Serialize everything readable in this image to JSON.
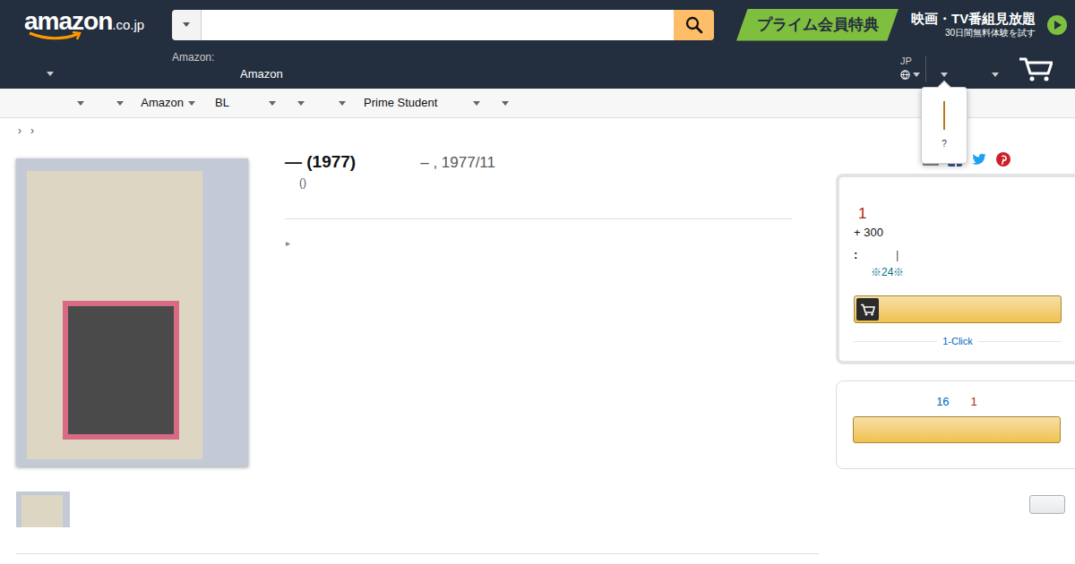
{
  "header": {
    "logo": {
      "text": "amazon",
      "suffix": ".co.jp"
    },
    "search": {
      "placeholder": ""
    },
    "prime_banner": {
      "badge": "プライム会員特典",
      "title": "映画・TV番組見放題",
      "subtitle": "30日間無料体験を試す"
    },
    "address": {
      "line1": "Amazon:",
      "line2": "Amazon"
    },
    "language": {
      "code": "JP"
    }
  },
  "nav": [
    {
      "label": ""
    },
    {
      "label": ""
    },
    {
      "label": "Amazon"
    },
    {
      "label": "BL"
    },
    {
      "label": ""
    },
    {
      "label": ""
    },
    {
      "label": "Prime Student"
    },
    {
      "label": ""
    }
  ],
  "tooltip": {
    "text": "?"
  },
  "breadcrumb": [
    "›",
    "›"
  ],
  "product": {
    "title": "— (1977)",
    "meta": "– , 1977/11",
    "byline": "()",
    "expander": "▸"
  },
  "buy_box": {
    "price": "1",
    "shipping": "+ 300",
    "delivery_label": ":",
    "delivery_value": "|",
    "note": "※24※",
    "one_click": "1-Click"
  },
  "offers": {
    "count": "16",
    "price": "1"
  }
}
